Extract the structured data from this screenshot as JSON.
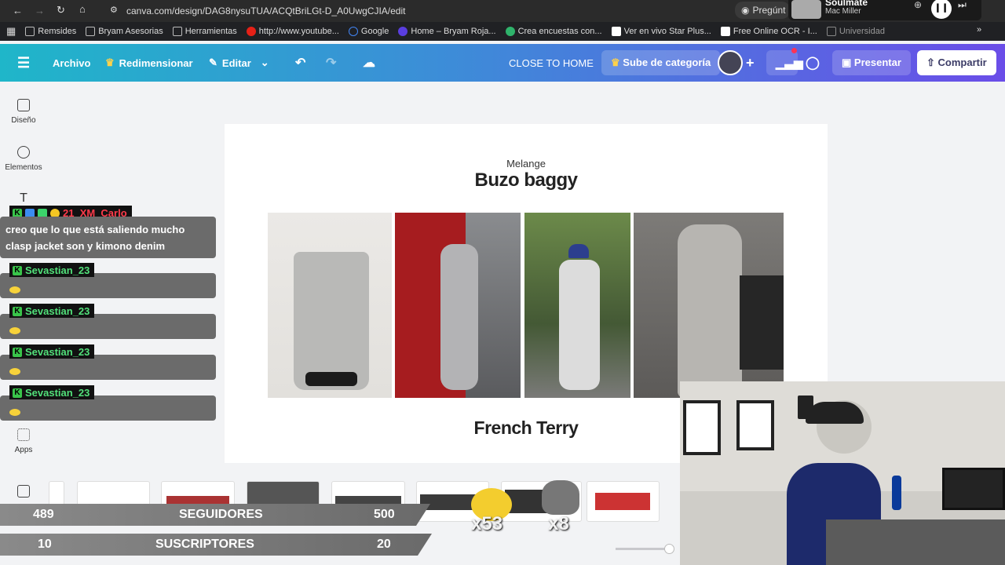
{
  "browser": {
    "url": "canva.com/design/DAG8nysuTUA/ACQtBriLGt-D_A0UwgCJIA/edit",
    "ask_label": "Pregúnt",
    "media": {
      "title": "Soulmate",
      "artist": "Mac Miller"
    },
    "bookmarks": [
      "Remsides",
      "Bryam Asesorias",
      "Herramientas",
      "http://www.youtube...",
      "Google",
      "Home – Bryam Roja...",
      "Crea encuestas con...",
      "Ver en vivo Star Plus...",
      "Free Online OCR - I...",
      "Universidad"
    ]
  },
  "toolbar": {
    "archivo": "Archivo",
    "redimensionar": "Redimensionar",
    "editar": "Editar",
    "title": "CLOSE TO HOME",
    "upgrade": "Sube de categoría",
    "presentar": "Presentar",
    "compartir": "Compartir"
  },
  "rail": {
    "diseno": "Diseño",
    "elementos": "Elementos",
    "apps": "Apps"
  },
  "chat": {
    "user1": "21_XM_Carlo",
    "message1": "creo que lo que está saliendo mucho clasp jacket son y kimono denim",
    "user2": "Sevastian_23"
  },
  "canvas": {
    "subtitle": "Melange",
    "title": "Buzo baggy",
    "section2": "French Terry"
  },
  "stats": {
    "followers_current": "489",
    "followers_label": "SEGUIDORES",
    "followers_goal": "500",
    "subs_current": "10",
    "subs_label": "SUSCRIPTORES",
    "subs_goal": "20",
    "combo1": "x53",
    "combo2": "x8"
  },
  "accent": "#7d2ae8"
}
